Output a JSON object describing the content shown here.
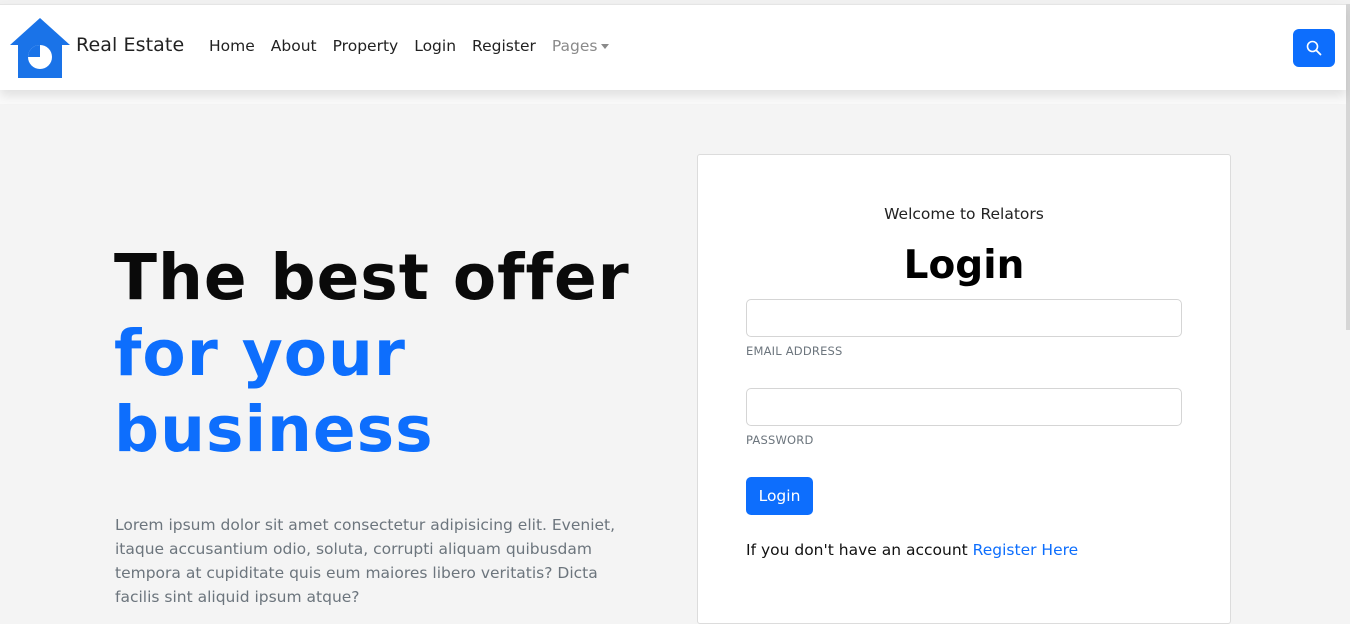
{
  "brand": {
    "name": "Real Estate",
    "logo_icon": "house-pie-icon",
    "accent_color": "#0d6efd"
  },
  "nav": {
    "links": [
      "Home",
      "About",
      "Property",
      "Login",
      "Register"
    ],
    "pages_label": "Pages",
    "search_icon": "search-icon"
  },
  "hero": {
    "title_line1": "The best offer",
    "title_line2": "for your",
    "title_line3": "business",
    "description": "Lorem ipsum dolor sit amet consectetur adipisicing elit. Eveniet, itaque accusantium odio, soluta, corrupti aliquam quibusdam tempora at cupiditate quis eum maiores libero veritatis? Dicta facilis sint aliquid ipsum atque?"
  },
  "login_card": {
    "welcome": "Welcome to Relators",
    "title": "Login",
    "email_label": "EMAIL ADDRESS",
    "email_value": "",
    "password_label": "PASSWORD",
    "password_value": "",
    "submit_label": "Login",
    "register_prompt": "If you don't have an account",
    "register_link": "Register Here"
  }
}
